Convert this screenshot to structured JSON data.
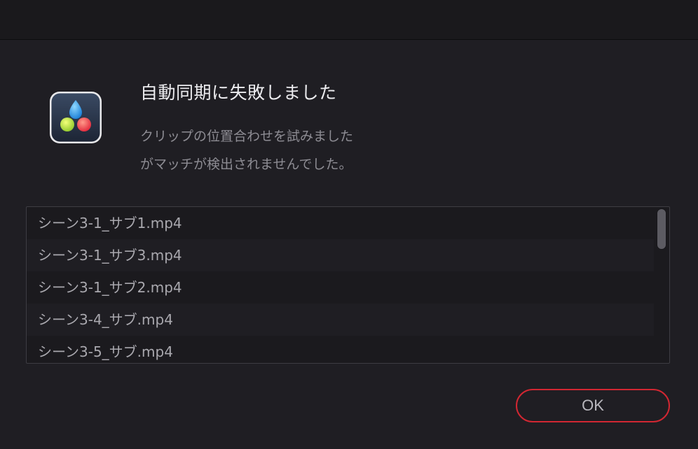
{
  "dialog": {
    "title": "自動同期に失敗しました",
    "message_lines": [
      "クリップの位置合わせを試みました",
      "がマッチが検出されませんでした。"
    ],
    "app_icon": "davinci-resolve-icon",
    "ok_label": "OK",
    "ok_border_color": "#d22732"
  },
  "clip_list": {
    "items": [
      "シーン3-1_サブ1.mp4",
      "シーン3-1_サブ3.mp4",
      "シーン3-1_サブ2.mp4",
      "シーン3-4_サブ.mp4",
      "シーン3-5_サブ.mp4"
    ]
  }
}
